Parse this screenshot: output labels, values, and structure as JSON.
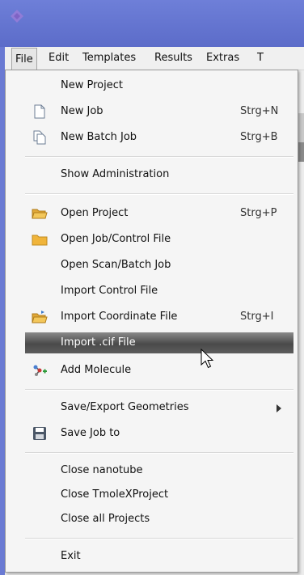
{
  "menubar": {
    "items": [
      {
        "label": "File"
      },
      {
        "label": "Edit"
      },
      {
        "label": "Templates"
      },
      {
        "label": "Results"
      },
      {
        "label": "Extras"
      },
      {
        "label": "T"
      }
    ]
  },
  "file_menu": {
    "items": [
      {
        "label": "New Project",
        "shortcut": ""
      },
      {
        "label": "New Job",
        "shortcut": "Strg+N",
        "icon": "new-document-icon"
      },
      {
        "label": "New Batch Job",
        "shortcut": "Strg+B",
        "icon": "batch-documents-icon"
      },
      {
        "label": "Show Administration",
        "shortcut": ""
      },
      {
        "label": "Open Project",
        "shortcut": "Strg+P",
        "icon": "open-folder-icon"
      },
      {
        "label": "Open Job/Control File",
        "shortcut": "",
        "icon": "folder-icon"
      },
      {
        "label": "Open Scan/Batch Job",
        "shortcut": ""
      },
      {
        "label": "Import Control File",
        "shortcut": ""
      },
      {
        "label": "Import Coordinate File",
        "shortcut": "Strg+I",
        "icon": "import-folder-icon"
      },
      {
        "label": "Import .cif File",
        "shortcut": ""
      },
      {
        "label": "Add Molecule",
        "shortcut": "",
        "icon": "molecule-add-icon"
      },
      {
        "label": "Save/Export Geometries",
        "shortcut": ""
      },
      {
        "label": "Save Job to",
        "shortcut": "",
        "icon": "floppy-disk-icon"
      },
      {
        "label": "Close nanotube",
        "shortcut": ""
      },
      {
        "label": "Close TmoleXProject",
        "shortcut": ""
      },
      {
        "label": "Close all Projects",
        "shortcut": ""
      },
      {
        "label": "Exit",
        "shortcut": ""
      }
    ]
  },
  "colors": {
    "titlebar": "#6272cf",
    "highlight": "#555555",
    "menu_bg": "#f5f5f5"
  }
}
